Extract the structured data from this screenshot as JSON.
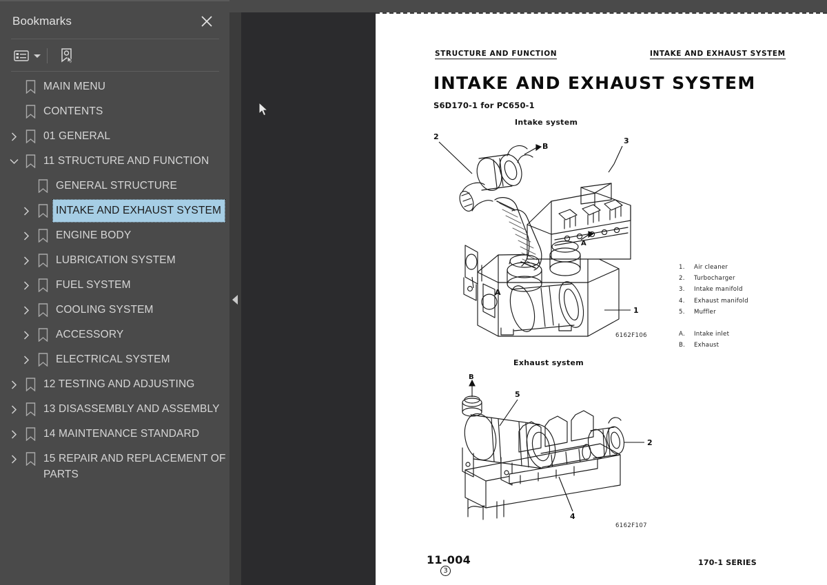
{
  "sidebar": {
    "title": "Bookmarks",
    "close_icon": "close-icon",
    "toolbar": {
      "options_icon": "list-options-icon",
      "caret_icon": "chevron-down-icon",
      "new_bookmark_icon": "new-bookmark-icon"
    },
    "items": [
      {
        "label": "MAIN MENU",
        "level": 0,
        "twisty": "none",
        "selected": false
      },
      {
        "label": "CONTENTS",
        "level": 0,
        "twisty": "none",
        "selected": false
      },
      {
        "label": "01 GENERAL",
        "level": 0,
        "twisty": "collapsed",
        "selected": false
      },
      {
        "label": "11 STRUCTURE AND FUNCTION",
        "level": 0,
        "twisty": "expanded",
        "selected": false
      },
      {
        "label": "GENERAL STRUCTURE",
        "level": 1,
        "twisty": "none",
        "selected": false
      },
      {
        "label": "INTAKE AND EXHAUST SYSTEM",
        "level": 1,
        "twisty": "collapsed",
        "selected": true
      },
      {
        "label": "ENGINE BODY",
        "level": 1,
        "twisty": "collapsed",
        "selected": false
      },
      {
        "label": "LUBRICATION SYSTEM",
        "level": 1,
        "twisty": "collapsed",
        "selected": false
      },
      {
        "label": "FUEL SYSTEM",
        "level": 1,
        "twisty": "collapsed",
        "selected": false
      },
      {
        "label": "COOLING SYSTEM",
        "level": 1,
        "twisty": "collapsed",
        "selected": false
      },
      {
        "label": "ACCESSORY",
        "level": 1,
        "twisty": "collapsed",
        "selected": false
      },
      {
        "label": "ELECTRICAL SYSTEM",
        "level": 1,
        "twisty": "collapsed",
        "selected": false
      },
      {
        "label": "12 TESTING AND ADJUSTING",
        "level": 0,
        "twisty": "collapsed",
        "selected": false
      },
      {
        "label": "13 DISASSEMBLY AND ASSEMBLY",
        "level": 0,
        "twisty": "collapsed",
        "selected": false
      },
      {
        "label": "14 MAINTENANCE STANDARD",
        "level": 0,
        "twisty": "collapsed",
        "selected": false
      },
      {
        "label": "15 REPAIR AND REPLACEMENT OF PARTS",
        "level": 0,
        "twisty": "collapsed",
        "selected": false
      }
    ]
  },
  "splitter": {
    "collapse_icon": "collapse-panel-triangle-icon"
  },
  "document": {
    "running_head_left": "STRUCTURE  AND  FUNCTION",
    "running_head_right": "INTAKE  AND  EXHAUST  SYSTEM",
    "title": "INTAKE  AND  EXHAUST  SYSTEM",
    "subtitle": "S6D170-1 for PC650-1",
    "figures": [
      {
        "caption": "Intake system",
        "code": "6162F106",
        "callouts": [
          "2",
          "B",
          "3",
          "A",
          "1"
        ]
      },
      {
        "caption": "Exhaust system",
        "code": "6162F107",
        "callouts": [
          "B",
          "5",
          "2",
          "4"
        ]
      }
    ],
    "legend": [
      {
        "key": "1.",
        "text": "Air cleaner"
      },
      {
        "key": "2.",
        "text": "Turbocharger"
      },
      {
        "key": "3.",
        "text": "Intake manifold"
      },
      {
        "key": "4.",
        "text": "Exhaust manifold"
      },
      {
        "key": "5.",
        "text": "Muffler"
      }
    ],
    "legend2": [
      {
        "key": "A.",
        "text": "Intake inlet"
      },
      {
        "key": "B.",
        "text": "Exhaust"
      }
    ],
    "footer": {
      "page_number": "11-004",
      "revision": "3",
      "series": "170-1 SERIES"
    }
  },
  "cursor": {
    "icon": "mouse-arrow-cursor"
  }
}
